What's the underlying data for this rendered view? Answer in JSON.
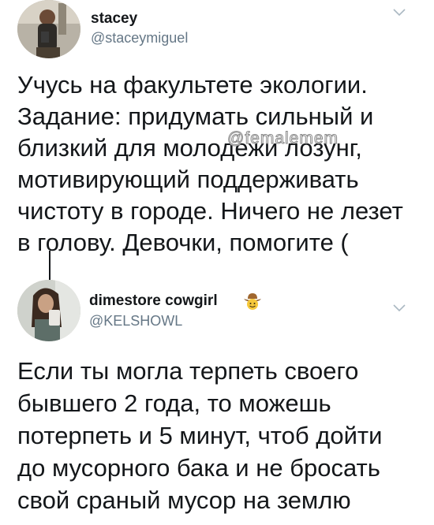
{
  "tweets": [
    {
      "display_name": "stacey",
      "handle": "@staceymiguel",
      "text": "Учусь на факультете экологии.\nЗадание: придумать сильный и\nблизкий для молодежи лозунг,\nмотивирующий поддерживать\nчистоту в городе. Ничего не лезет\nв голову. Девочки, помогите (",
      "menu_icon": "chevron-down-icon"
    },
    {
      "display_name": "dimestore cowgirl",
      "name_emoji": "cowboy-hat-face-icon",
      "handle": "@KELSHOWL",
      "text": "Если ты могла терпеть своего\nбывшего 2 года, то можешь\nпотерпеть и 5 минут, чтоб дойти\nдо мусорного бака и не бросать\nсвой сраный мусор на землю",
      "menu_icon": "chevron-down-icon"
    }
  ],
  "watermark": "@femalemem",
  "colors": {
    "text": "#14171a",
    "secondary": "#657786",
    "background": "#ffffff"
  }
}
